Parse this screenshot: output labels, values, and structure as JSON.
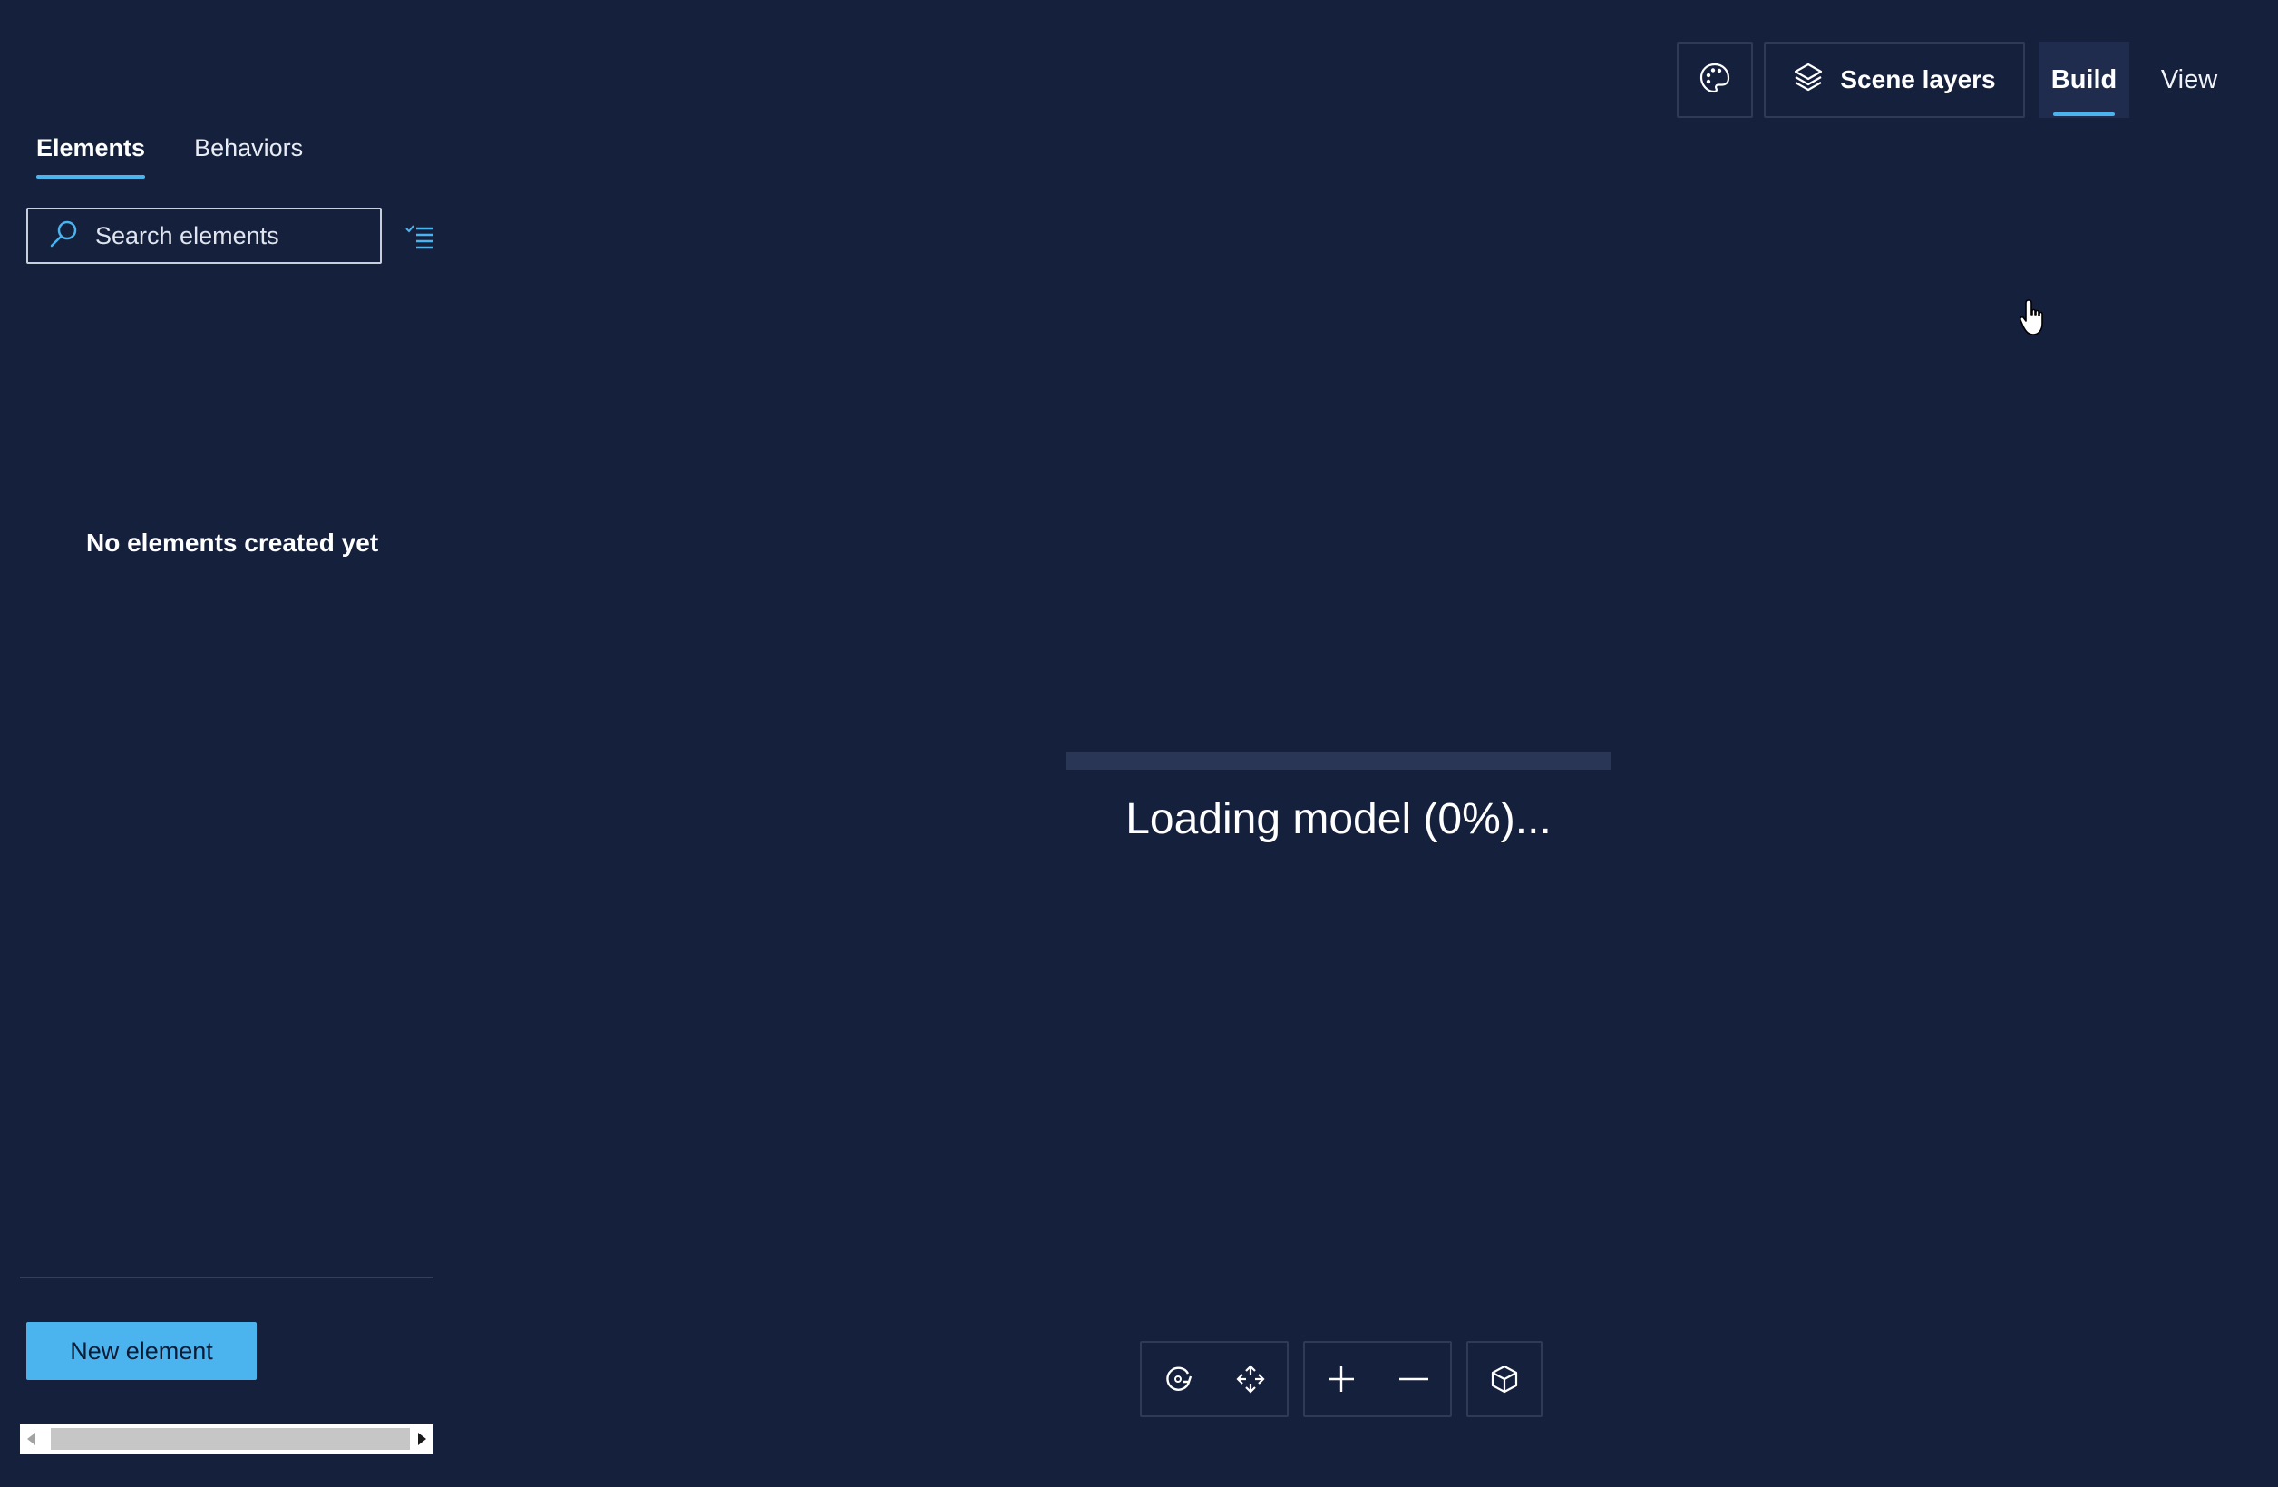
{
  "left_panel": {
    "tabs": [
      {
        "label": "Elements",
        "active": true
      },
      {
        "label": "Behaviors",
        "active": false
      }
    ],
    "search": {
      "placeholder": "Search elements",
      "value": ""
    },
    "empty_state": "No elements created yet",
    "new_element_label": "New element"
  },
  "toolbar": {
    "theme_icon": "palette-icon",
    "scene_layers_label": "Scene layers",
    "build_label": "Build",
    "view_label": "View",
    "active_mode": "Build"
  },
  "loading": {
    "text": "Loading model (0%)...",
    "progress": 0
  },
  "camera_controls": {
    "icons": [
      "orbit-icon",
      "pan-icon",
      "zoom-in-icon",
      "zoom-out-icon",
      "reset-view-cube-icon"
    ]
  },
  "colors": {
    "background": "#15203d",
    "accent": "#4bb4ee",
    "border": "#2e3a56"
  }
}
